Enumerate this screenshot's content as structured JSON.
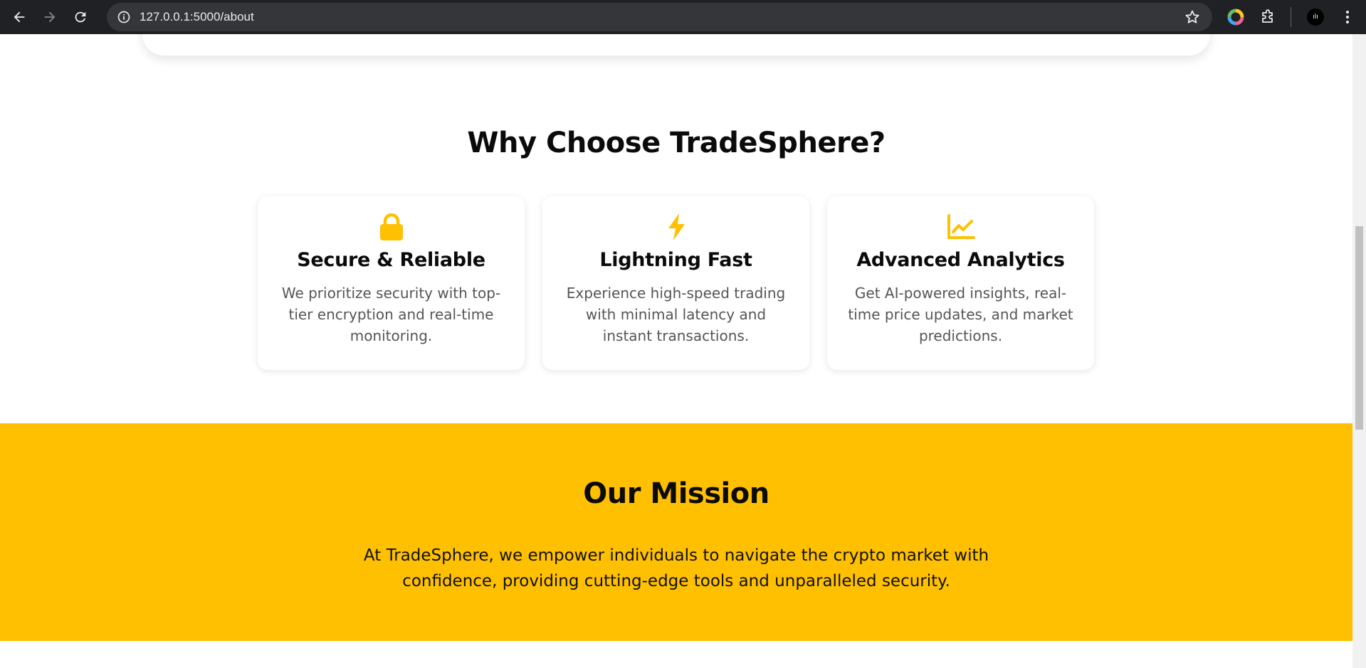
{
  "browser": {
    "url": "127.0.0.1:5000/about",
    "avatar_text": "ılı"
  },
  "why": {
    "title": "Why Choose TradeSphere?",
    "cards": [
      {
        "icon": "lock-icon",
        "title": "Secure & Reliable",
        "description": "We prioritize security with top-tier encryption and real-time monitoring."
      },
      {
        "icon": "lightning-bolt-icon",
        "title": "Lightning Fast",
        "description": "Experience high-speed trading with minimal latency and instant transactions."
      },
      {
        "icon": "chart-line-icon",
        "title": "Advanced Analytics",
        "description": "Get AI-powered insights, real-time price updates, and market predictions."
      }
    ]
  },
  "mission": {
    "title": "Our Mission",
    "text": "At TradeSphere, we empower individuals to navigate the crypto market with confidence, providing cutting-edge tools and unparalleled security."
  },
  "colors": {
    "accent": "#ffc001",
    "chrome_bg": "#202124"
  }
}
